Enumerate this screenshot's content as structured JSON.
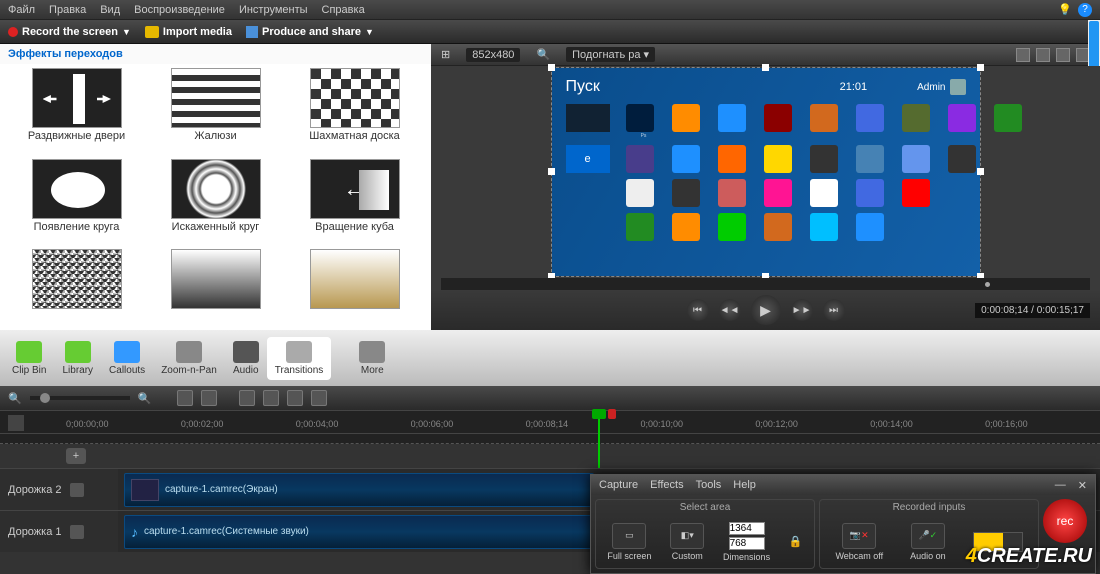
{
  "menu": {
    "file": "Файл",
    "edit": "Правка",
    "view": "Вид",
    "play": "Воспроизведение",
    "tools": "Инструменты",
    "help": "Справка"
  },
  "toolbar": {
    "record": "Record the screen",
    "import": "Import media",
    "produce": "Produce and share"
  },
  "transitions_panel": {
    "title": "Эффекты переходов",
    "items": [
      "Раздвижные двери",
      "Жалюзи",
      "Шахматная доска",
      "Появление круга",
      "Искаженный круг",
      "Вращение куба",
      "",
      "",
      ""
    ]
  },
  "tabs": {
    "clipbin": "Clip Bin",
    "library": "Library",
    "callouts": "Callouts",
    "zoom": "Zoom-n-Pan",
    "audio": "Audio",
    "transitions": "Transitions",
    "more": "More"
  },
  "preview": {
    "dim": "852x480",
    "fit": "Подогнать ра",
    "start_title": "Пуск",
    "time": "21:01",
    "user": "Admin",
    "timecode": "0:00:08;14 / 0:00:15;17"
  },
  "ruler": [
    "0;00:00;00",
    "0;00:02;00",
    "0;00:04;00",
    "0;00:06;00",
    "0;00:08;14",
    "0;00:10;00",
    "0;00:12;00",
    "0;00:14;00",
    "0;00:16;00"
  ],
  "tracks": {
    "t2": "Дорожка 2",
    "t1": "Дорожка 1",
    "clip2": "capture-1.camrec(Экран)",
    "clip1": "capture-1.camrec(Системные звуки)"
  },
  "recorder": {
    "menu": {
      "capture": "Capture",
      "effects": "Effects",
      "tools": "Tools",
      "help": "Help"
    },
    "select_area": "Select area",
    "recorded": "Recorded inputs",
    "fullscreen": "Full screen",
    "custom": "Custom",
    "dimensions": "Dimensions",
    "w": "1364",
    "h": "768",
    "webcam": "Webcam off",
    "audio": "Audio on",
    "rec": "rec"
  },
  "watermark_a": "4",
  "watermark_b": "CREATE.RU"
}
